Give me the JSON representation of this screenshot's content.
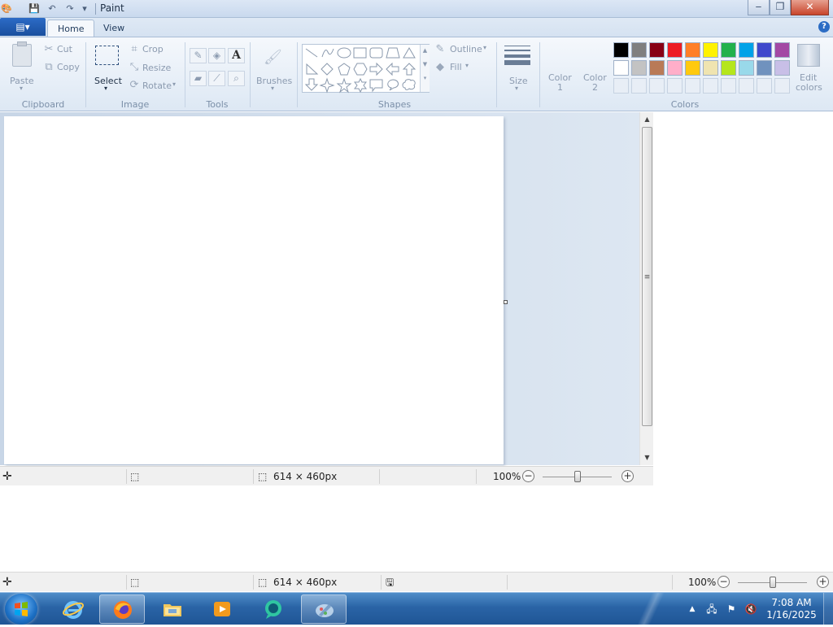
{
  "window": {
    "title": "Paint",
    "minimize_glyph": "‒",
    "maximize_glyph": "❐",
    "close_glyph": "✕"
  },
  "ribbon": {
    "app_menu_glyph": "▤▾",
    "tabs": [
      {
        "label": "Home",
        "active": true
      },
      {
        "label": "View",
        "active": false
      }
    ],
    "help_glyph": "?",
    "clipboard": {
      "paste": "Paste",
      "cut": "Cut",
      "copy": "Copy",
      "group": "Clipboard"
    },
    "image": {
      "select": "Select",
      "crop": "Crop",
      "resize": "Resize",
      "rotate": "Rotate",
      "group": "Image"
    },
    "tools": {
      "group": "Tools",
      "text_tool_glyph": "A"
    },
    "brushes": {
      "label": "Brushes"
    },
    "shapes": {
      "group": "Shapes",
      "outline": "Outline",
      "fill": "Fill"
    },
    "size": {
      "label": "Size"
    },
    "colors": {
      "color1_line1": "Color",
      "color1_line2": "1",
      "color2_line1": "Color",
      "color2_line2": "2",
      "edit_line1": "Edit",
      "edit_line2": "colors",
      "group": "Colors",
      "palette_row1": [
        "#000000",
        "#7f7f7f",
        "#880015",
        "#ed1c24",
        "#ff7f27",
        "#fff200",
        "#22b14c",
        "#00a2e8",
        "#3f48cc",
        "#a349a4"
      ],
      "palette_row2": [
        "#ffffff",
        "#c3c3c3",
        "#b97a57",
        "#ffaec9",
        "#ffc90e",
        "#efe4b0",
        "#b5e61d",
        "#99d9ea",
        "#7092be",
        "#c8bfe7"
      ]
    }
  },
  "status_top": {
    "dimensions": "614 × 460px",
    "zoom": "100%",
    "zoom_level": 0.5
  },
  "status_bottom": {
    "dimensions": "614 × 460px",
    "zoom": "100%",
    "zoom_level": 0.5
  },
  "taskbar": {
    "time": "7:08 AM",
    "date": "1/16/2025",
    "tray_up_glyph": "▲"
  }
}
